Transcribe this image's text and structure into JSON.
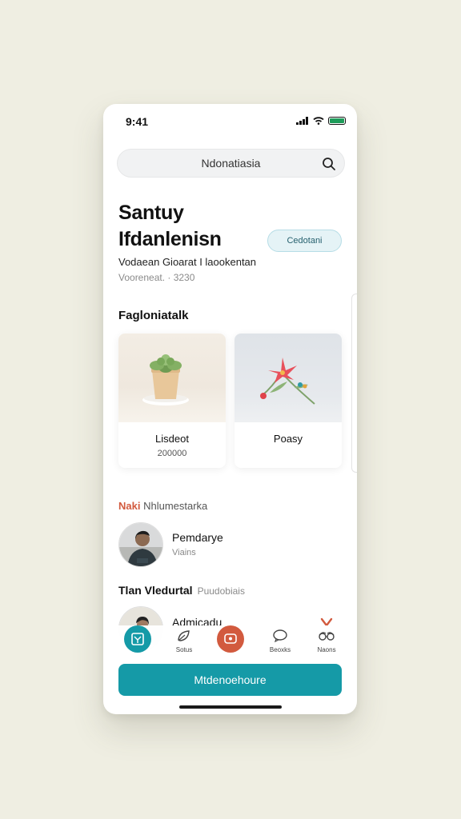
{
  "status": {
    "time": "9:41"
  },
  "search": {
    "value": "Ndonatiasia"
  },
  "hero": {
    "title_line1": "Santuy",
    "title_line2": "Ifdanlenisn",
    "cta_label": "Cedotani",
    "subtitle": "Vodaean Gioarat I laookentan",
    "meta": "Vooreneat. · 3230"
  },
  "featured": {
    "title": "Fagloniatalk",
    "cards": [
      {
        "name": "Lisdeot",
        "price": "200000"
      },
      {
        "name": "Poasy",
        "price": ""
      }
    ]
  },
  "recommend": {
    "accent": "Naki",
    "label": "Nhlumestarka",
    "row1": {
      "name": "Pemdarye",
      "sub": "Viains"
    },
    "row2_title": "Tlan Vledurtal",
    "row2_label": "Puudobiais",
    "row2_name": "Admicadu"
  },
  "tabs": [
    {
      "label": "",
      "icon": "home-icon"
    },
    {
      "label": "Sotus",
      "icon": "leaf-icon"
    },
    {
      "label": "",
      "icon": "chat-icon"
    },
    {
      "label": "Beoxks",
      "icon": "bubble-icon"
    },
    {
      "label": "Naons",
      "icon": "glasses-icon"
    }
  ],
  "primary_button": "Mtdenoehoure",
  "colors": {
    "accent_teal": "#159aa7",
    "accent_coral": "#d25a3e",
    "battery_green": "#1e9c5a"
  }
}
